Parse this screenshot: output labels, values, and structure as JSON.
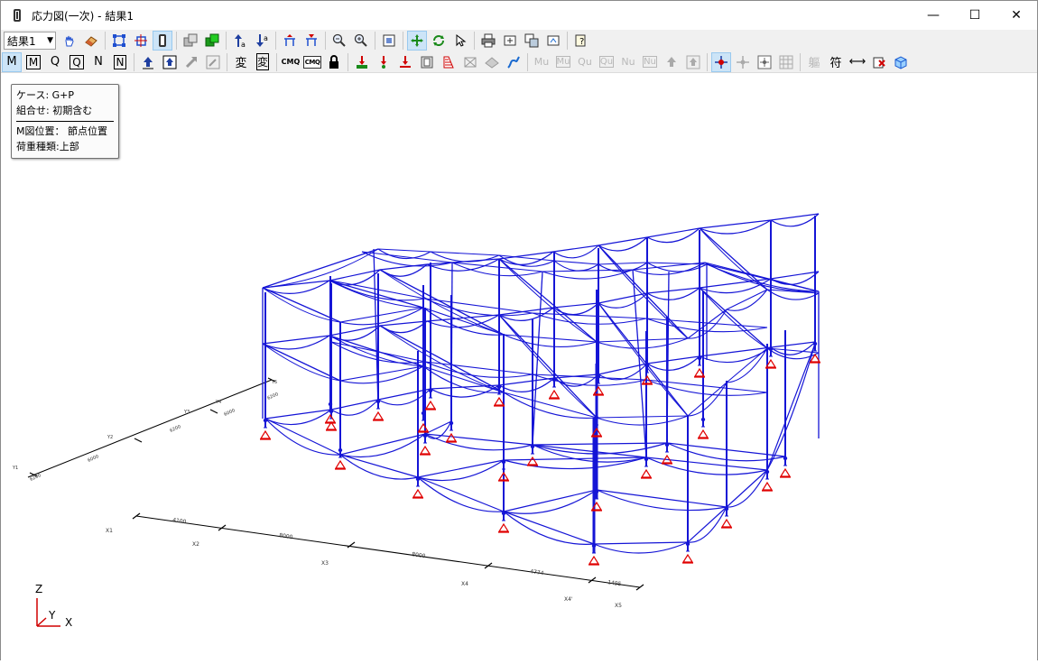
{
  "window": {
    "title": "応力図(一次) - 結果1",
    "minimize": "—",
    "maximize": "☐",
    "close": "✕"
  },
  "toolbar1": {
    "result_select": "結果1"
  },
  "toolbar2": {
    "M": "M",
    "M_boxed": "M",
    "Q": "Q",
    "Q_boxed": "Q",
    "N": "N",
    "N_boxed": "N",
    "deform": "変",
    "deform_boxed": "変",
    "cmq1": "CMQ",
    "cmq2": "CMQ",
    "Mu": "Mu",
    "Mu_boxed": "Mu",
    "Qu": "Qu",
    "Qu_boxed": "Qu",
    "Nu": "Nu",
    "Nu_boxed": "Nu",
    "frame": "軀",
    "symbol": "符",
    "dim": "⟷"
  },
  "infobox": {
    "case": "ケース: G+P",
    "combination": "組合せ: 初期含む",
    "m_position": "M図位置： 節点位置",
    "load_type": "荷重種類:上部"
  },
  "axis_labels": {
    "x1": "X1",
    "x2": "X2",
    "x3": "X3",
    "x4": "X4",
    "x4p": "X4'",
    "x5": "X5",
    "d1": "4100",
    "d2": "8000",
    "d3": "8000",
    "d4": "4774",
    "d5": "1495",
    "y5": "Y5",
    "y4": "Y4",
    "y3": "Y3",
    "y2": "Y2",
    "y1": "Y1",
    "dy1": "6200",
    "dy2": "6000",
    "dy3": "6200",
    "dy4": "6000",
    "dy5": "6200"
  },
  "triad": {
    "z": "Z",
    "y": "Y",
    "x": "X"
  },
  "colors": {
    "frame": "#1515d6",
    "support": "#e00000",
    "axis": "#000000"
  }
}
